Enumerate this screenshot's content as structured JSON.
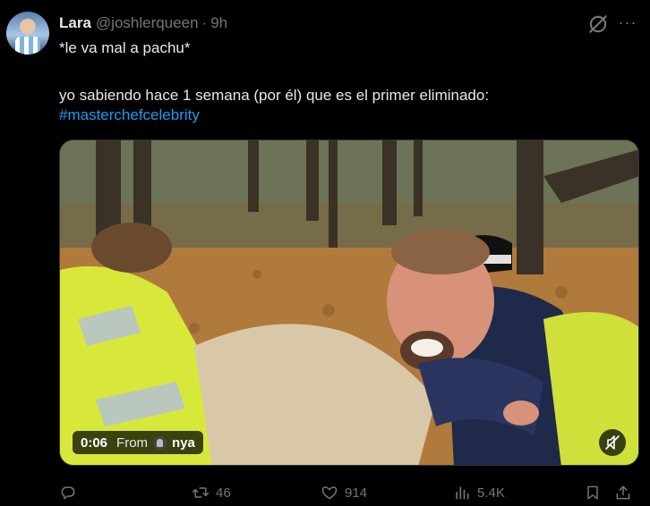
{
  "tweet": {
    "author_name": "Lara",
    "author_handle": "@joshlerqueen",
    "separator": "·",
    "time": "9h",
    "text_line1": "*le va mal a pachu*",
    "text_line2": "yo sabiendo hace 1 semana (por él) que es el primer eliminado:",
    "hashtag": "#masterchefcelebrity"
  },
  "video": {
    "timestamp": "0:06",
    "from_label": "From",
    "source_name": "nya"
  },
  "actions": {
    "reply_count": "",
    "retweet_count": "46",
    "like_count": "914",
    "views_count": "5.4K"
  },
  "colors": {
    "background": "#000000",
    "text": "#e7e9ea",
    "muted": "#71767b",
    "link": "#1d9bf0"
  },
  "icons": [
    "grok-icon",
    "more-icon",
    "reply-icon",
    "retweet-icon",
    "like-icon",
    "views-icon",
    "bookmark-icon",
    "share-icon",
    "mute-icon"
  ]
}
